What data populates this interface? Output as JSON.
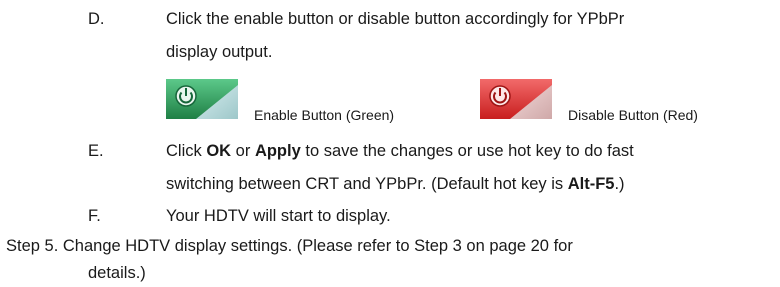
{
  "items": {
    "d": {
      "letter": "D.",
      "line1": "Click the enable button or disable button accordingly for YPbPr",
      "line2": "display output."
    },
    "buttons": {
      "enable_caption": "Enable Button (Green)",
      "disable_caption": "Disable Button (Red)",
      "enable_color": "#2e9b5a",
      "disable_color": "#e03030"
    },
    "e": {
      "letter": "E.",
      "line1_pre": "Click ",
      "line1_ok": "OK",
      "line1_mid": " or ",
      "line1_apply": "Apply",
      "line1_post": " to save the changes or use hot key to do fast",
      "line2_pre": "switching between CRT and YPbPr. (Default hot key is ",
      "line2_key": "Alt-F5",
      "line2_post": ".)"
    },
    "f": {
      "letter": "F.",
      "line1": "Your HDTV will start to display."
    }
  },
  "step5": {
    "line1": "Step 5. Change HDTV display settings. (Please refer to Step 3 on page 20 for",
    "line2": "details.)"
  }
}
